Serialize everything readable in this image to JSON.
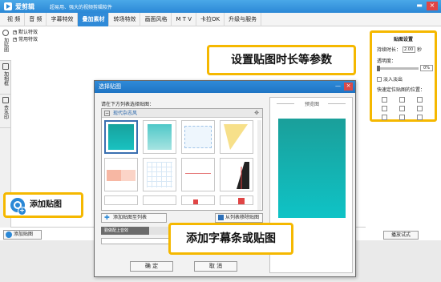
{
  "app": {
    "name": "爱剪辑",
    "slogan": "超易用、强大的视频剪辑软件",
    "window_buttons": [
      "▬",
      "×"
    ]
  },
  "menu": {
    "items": [
      {
        "label": "视 频",
        "active": false
      },
      {
        "label": "音 频",
        "active": false
      },
      {
        "label": "字幕特效",
        "active": false
      },
      {
        "label": "叠加素材",
        "active": true
      },
      {
        "label": "转场特效",
        "active": false
      },
      {
        "label": "画面风格",
        "active": false
      },
      {
        "label": "M T V",
        "active": false
      },
      {
        "label": "卡拉OK",
        "active": false
      },
      {
        "label": "升级与服务",
        "active": false
      }
    ]
  },
  "sidebar": {
    "tabs": [
      {
        "label": "加贴图",
        "active": true
      },
      {
        "label": "加相框",
        "active": false
      },
      {
        "label": "去水印",
        "active": false
      }
    ]
  },
  "tree": {
    "items": [
      "默认特效",
      "常用特效"
    ]
  },
  "settings": {
    "title": "贴图设置",
    "duration_label": "持续时长：",
    "duration_value": "2.00",
    "duration_unit": "秒",
    "opacity_label": "透明度：",
    "opacity_value": "0%",
    "fade_label": "淡入淡出",
    "position_label": "快速定位贴图的位置："
  },
  "bottom": {
    "add_sticker_button": "添加贴图",
    "stop_button": "播放试式"
  },
  "callouts": {
    "top": "设置贴图时长等参数",
    "bottom": "添加字幕条或贴图",
    "left": "添加贴图"
  },
  "dialog": {
    "title": "选择贴图",
    "title_buttons": [
      "—",
      "×"
    ],
    "hint": "请在下方列表选择贴图：",
    "category": "现代杂志风",
    "add_to_list_button": "添加贴图至列表",
    "remove_button": "从列表移除贴图",
    "tip_flag": "勤做配上音效",
    "ok_button": "确 定",
    "cancel_button": "取 消",
    "preview_label": "预览图"
  },
  "colors": {
    "accent": "#2f8ad8",
    "callout_border": "#f5b800",
    "preview_teal": "#14b0b0"
  }
}
